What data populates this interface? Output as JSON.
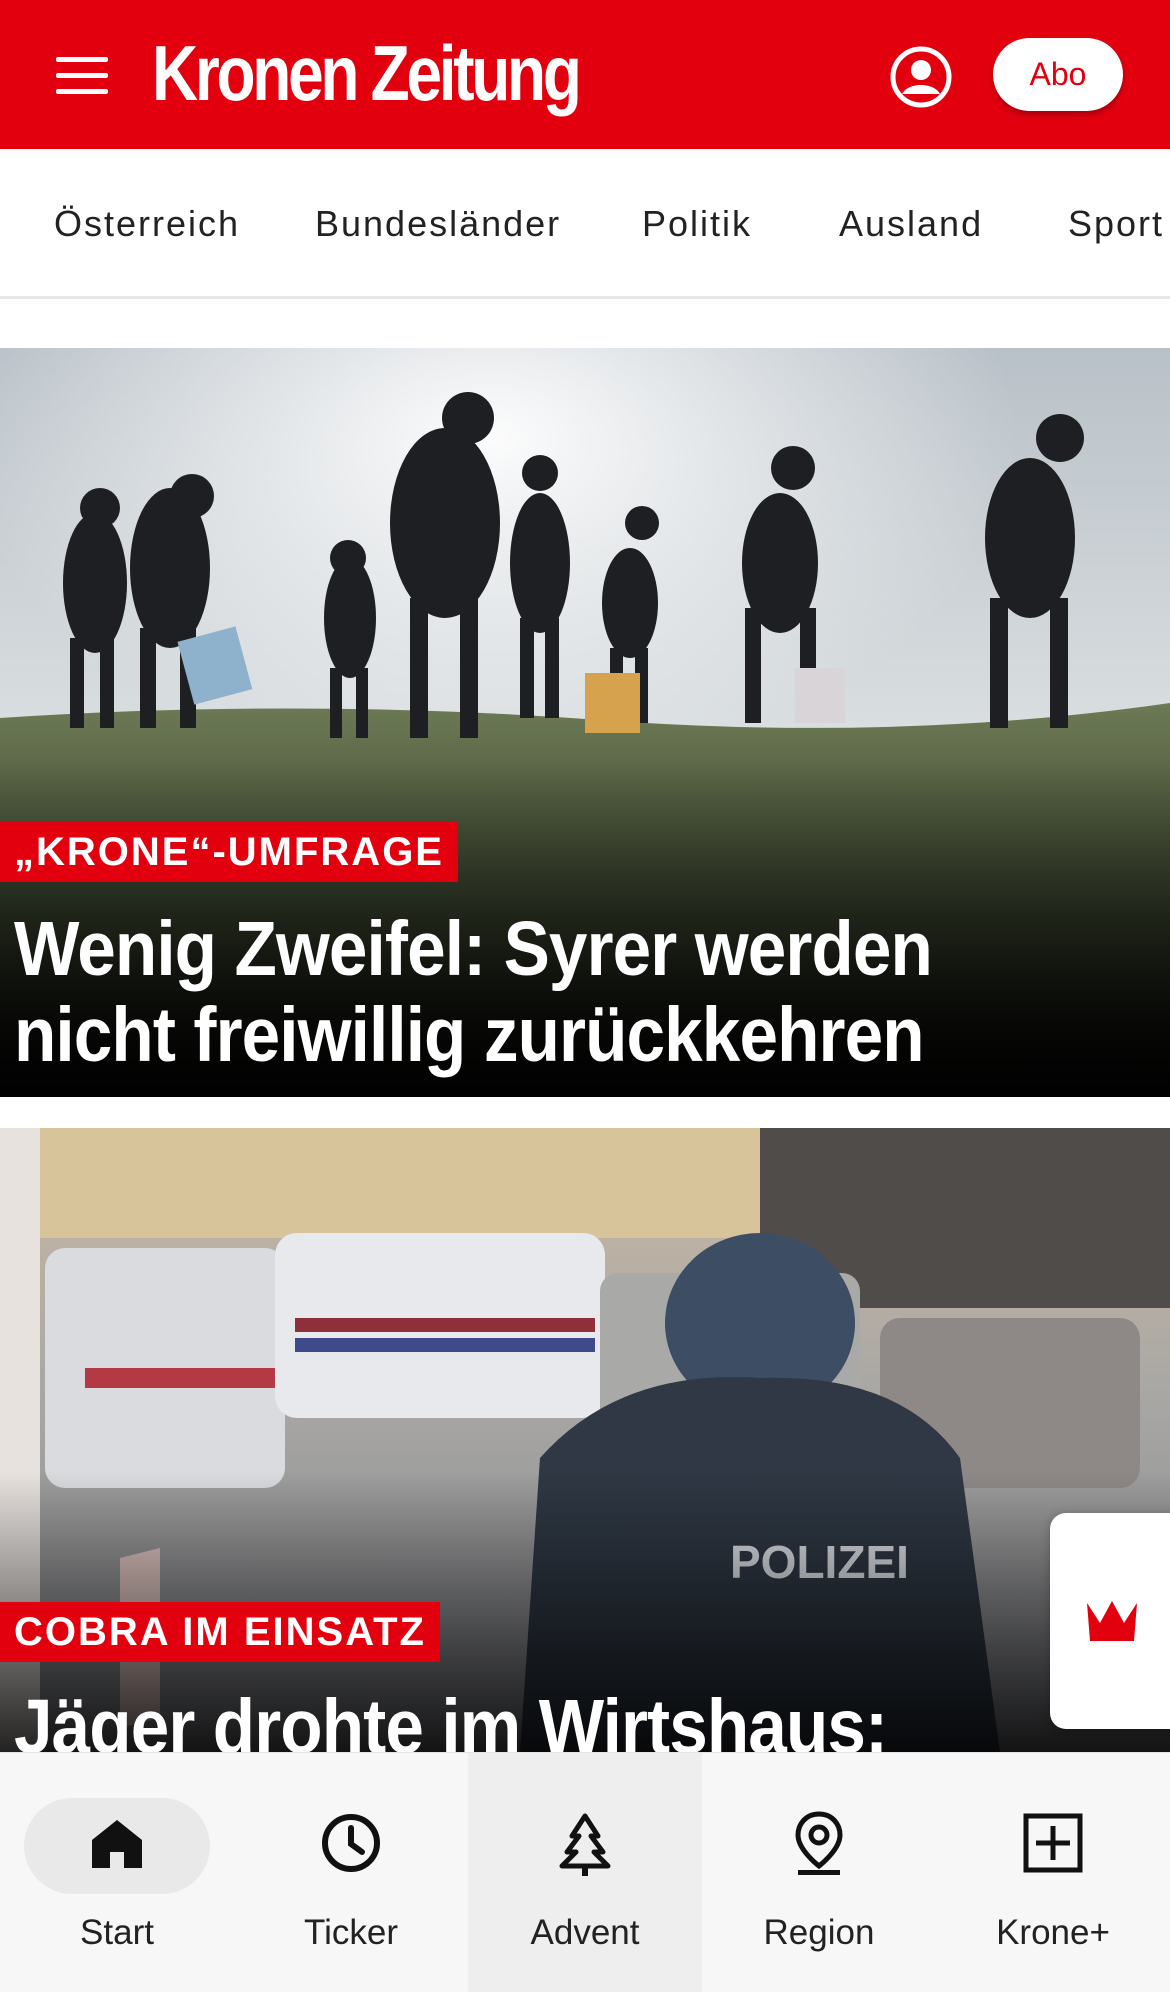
{
  "header": {
    "brand": "Kronen Zeitung",
    "abo_label": "Abo",
    "accent_color": "#e2000f"
  },
  "categories": [
    {
      "label": "Österreich"
    },
    {
      "label": "Bundesländer"
    },
    {
      "label": "Politik"
    },
    {
      "label": "Ausland"
    },
    {
      "label": "Sport"
    }
  ],
  "articles": [
    {
      "kicker": "„KRONE“-UMFRAGE",
      "headline_line1": "Wenig Zweifel: Syrer werden",
      "headline_line2": "nicht freiwillig zurückkehren"
    },
    {
      "kicker": "COBRA IM EINSATZ",
      "headline_line1": "Jäger drohte im Wirtshaus:",
      "photo_text": "POLIZEI"
    }
  ],
  "bottom_nav": [
    {
      "label": "Start",
      "icon": "home-icon",
      "active": true
    },
    {
      "label": "Ticker",
      "icon": "clock-icon"
    },
    {
      "label": "Advent",
      "icon": "tree-icon"
    },
    {
      "label": "Region",
      "icon": "location-pin-icon"
    },
    {
      "label": "Krone+",
      "icon": "plus-box-icon"
    }
  ],
  "floating_button": {
    "icon": "crown-icon"
  }
}
